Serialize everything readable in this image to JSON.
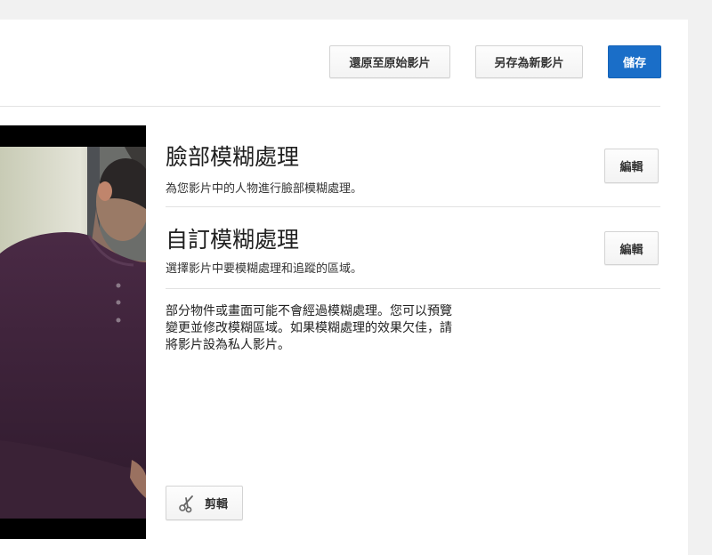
{
  "toolbar": {
    "revert_label": "還原至原始影片",
    "save_as_new_label": "另存為新影片",
    "save_label": "儲存"
  },
  "face_blur": {
    "title": "臉部模糊處理",
    "description": "為您影片中的人物進行臉部模糊處理。",
    "edit_label": "編輯"
  },
  "custom_blur": {
    "title": "自訂模糊處理",
    "description": "選擇影片中要模糊處理和追蹤的區域。",
    "edit_label": "編輯"
  },
  "notice": {
    "text": "部分物件或畫面可能不會經過模糊處理。您可以預覽\n變更並修改模糊區域。如果模糊處理的效果欠佳，請\n將影片設為私人影片。"
  },
  "trim": {
    "label": "剪輯",
    "icon": "scissors-icon"
  },
  "colors": {
    "primary": "#1a6ec8",
    "divider": "#e2e2e2"
  }
}
